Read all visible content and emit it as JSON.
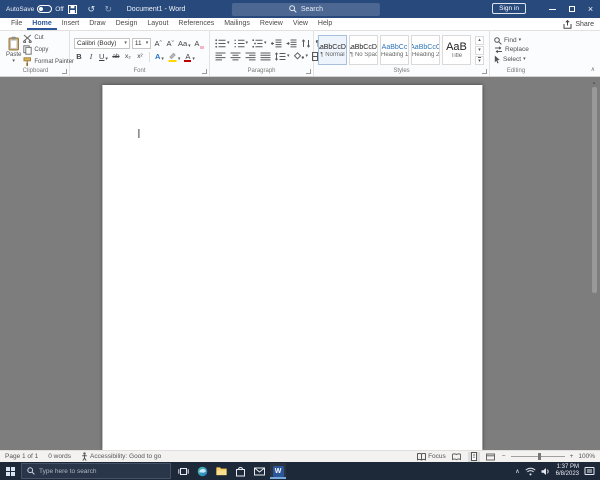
{
  "colors": {
    "accent": "#2b579a",
    "titlebar": "#27497c",
    "heading": "#2e74b5",
    "taskbar": "#1d2838",
    "highlight": "#ffd800",
    "fontred": "#c00000"
  },
  "icons": {
    "dropdown": "▾",
    "up": "▴",
    "down": "▾",
    "undo": "↺",
    "redo": "↻",
    "close": "×",
    "pilcrow": "¶",
    "chevron_up": "∧",
    "minus": "−",
    "plus": "+",
    "word_logo": "W"
  },
  "titlebar": {
    "autosave_label": "AutoSave",
    "autosave_state": "Off",
    "document_title": "Document1 - Word",
    "search_placeholder": "Search",
    "sign_in_label": "Sign in"
  },
  "tabs": [
    "File",
    "Home",
    "Insert",
    "Draw",
    "Design",
    "Layout",
    "References",
    "Mailings",
    "Review",
    "View",
    "Help"
  ],
  "share_label": "Share",
  "clipboard": {
    "label": "Clipboard",
    "paste": "Paste",
    "cut": "Cut",
    "copy": "Copy",
    "format_painter": "Format Painter"
  },
  "font": {
    "label": "Font",
    "family": "Calibri (Body)",
    "size": "11",
    "grow": "Aˆ",
    "shrink": "Aˇ",
    "change_case": "Aa",
    "clear": "A",
    "bold": "B",
    "italic": "I",
    "underline": "U",
    "strikethrough": "ab",
    "subscript": "x₂",
    "superscript": "x²",
    "effects": "A",
    "color": "A"
  },
  "paragraph": {
    "label": "Paragraph"
  },
  "styles": {
    "label": "Styles",
    "items": [
      {
        "preview": "AaBbCcDd",
        "name": "¶ Normal"
      },
      {
        "preview": "AaBbCcDd",
        "name": "¶ No Spac..."
      },
      {
        "preview": "AaBbCc",
        "name": "Heading 1"
      },
      {
        "preview": "AaBbCcC",
        "name": "Heading 2"
      },
      {
        "preview": "AaB",
        "name": "Title"
      }
    ]
  },
  "editing": {
    "label": "Editing",
    "find": "Find",
    "replace": "Replace",
    "select": "Select"
  },
  "statusbar": {
    "page": "Page 1 of 1",
    "words": "0 words",
    "accessibility": "Accessibility: Good to go",
    "focus": "Focus",
    "zoom": "100%"
  },
  "taskbar": {
    "search_placeholder": "Type here to search",
    "time": "1:37 PM",
    "date": "6/8/2023"
  }
}
